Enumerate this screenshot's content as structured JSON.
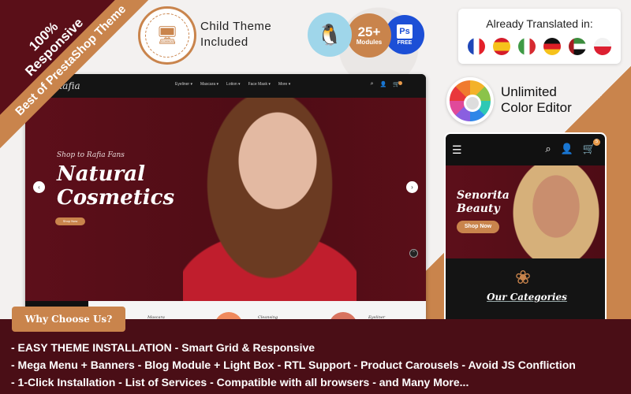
{
  "corner_badge": {
    "line1": "100%",
    "line2": "Responsive"
  },
  "ribbon": {
    "label": "Best of PrestaShop Theme"
  },
  "child_theme": {
    "line1": "Child Theme",
    "line2": "Included",
    "icon": "monitor-icon"
  },
  "badges": {
    "prestashop": {
      "icon": "puffin-icon"
    },
    "modules": {
      "count": "25+",
      "label": "Modules"
    },
    "photoshop": {
      "icon": "Ps",
      "label": "FREE"
    }
  },
  "translations": {
    "title": "Already Translated in:",
    "flags": [
      "French",
      "Spanish",
      "Italian",
      "German",
      "UAE",
      "Polish"
    ]
  },
  "color_editor": {
    "line1": "Unlimited",
    "line2": "Color Editor"
  },
  "desktop": {
    "logo": "Rafia",
    "menu": [
      "Eyeliner ▾",
      "Mascara ▾",
      "Lotion ▾",
      "Face Mask ▾",
      "More ▾"
    ],
    "hero_script": "Shop to Rafia Fans",
    "hero_title_line1": "Natural",
    "hero_title_line2": "Cosmetics",
    "shop_button": "Shop Now",
    "categories": [
      "Mascara",
      "Cleansing",
      "Eyeliner"
    ]
  },
  "mobile": {
    "cart_count": "5",
    "hero_title_line1": "Senorita",
    "hero_title_line2": "Beauty",
    "shop_button": "Shop Now",
    "categories_title": "Our Categories"
  },
  "why": {
    "label": "Why Choose Us?"
  },
  "features": {
    "line1": "-  EASY THEME INSTALLATION  -   Smart Grid & Responsive",
    "line2": "-  Mega Menu + Banners  -  Blog Module + Light Box  -  RTL Support   -  Product Carousels -  Avoid JS Confliction",
    "line3": "-  1-Click Installation  -  List of Services  -  Compatible with all browsers  -  and Many More..."
  },
  "colors": {
    "brand_dark": "#4a0e16",
    "accent": "#c9844c"
  }
}
